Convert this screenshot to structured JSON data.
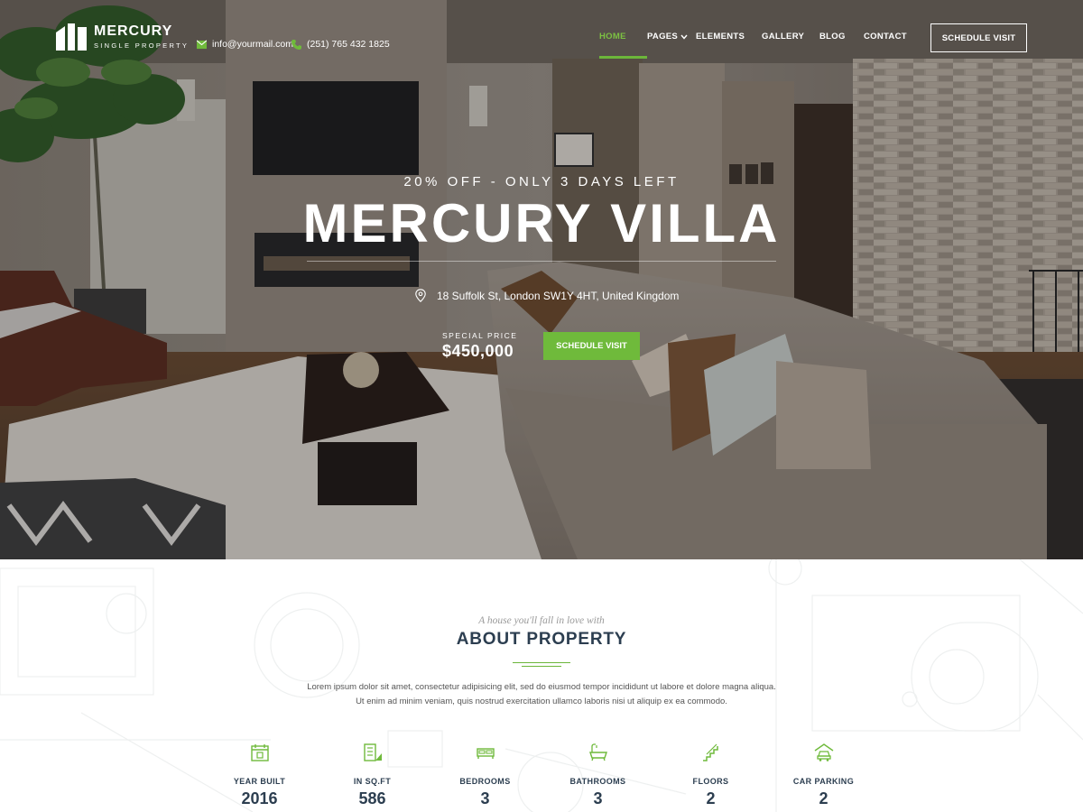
{
  "brand": {
    "name": "MERCURY",
    "tagline": "SINGLE PROPERTY"
  },
  "contact": {
    "email": "info@yourmail.com",
    "phone": "(251) 765 432 1825"
  },
  "nav": {
    "items": [
      {
        "label": "HOME",
        "active": true
      },
      {
        "label": "PAGES",
        "has_dropdown": true
      },
      {
        "label": "ELEMENTS"
      },
      {
        "label": "GALLERY"
      },
      {
        "label": "BLOG"
      },
      {
        "label": "CONTACT"
      }
    ],
    "cta_label": "SCHEDULE VISIT"
  },
  "hero": {
    "promo": "20% OFF - ONLY 3 DAYS LEFT",
    "title": "MERCURY VILLA",
    "address": "18 Suffolk St, London SW1Y 4HT, United Kingdom",
    "price_label": "SPECIAL PRICE",
    "price_value": "$450,000",
    "cta_label": "SCHEDULE VISIT"
  },
  "about": {
    "tagline": "A house you'll fall in love with",
    "title": "ABOUT PROPERTY",
    "text": "Lorem ipsum dolor sit amet, consectetur adipisicing elit, sed do eiusmod tempor incididunt ut labore et dolore magna aliqua. Ut enim ad minim veniam, quis nostrud exercitation ullamco laboris nisi ut aliquip ex ea commodo.",
    "features": [
      {
        "icon": "calendar-icon",
        "label": "YEAR BUILT",
        "value": "2016"
      },
      {
        "icon": "building-area-icon",
        "label": "IN SQ.FT",
        "value": "586"
      },
      {
        "icon": "bed-icon",
        "label": "BEDROOMS",
        "value": "3"
      },
      {
        "icon": "bathtub-icon",
        "label": "BATHROOMS",
        "value": "3"
      },
      {
        "icon": "stairs-icon",
        "label": "FLOORS",
        "value": "2"
      },
      {
        "icon": "car-icon",
        "label": "CAR PARKING",
        "value": "2"
      }
    ]
  },
  "colors": {
    "accent": "#6fba3b",
    "heading": "#2c3e50"
  }
}
